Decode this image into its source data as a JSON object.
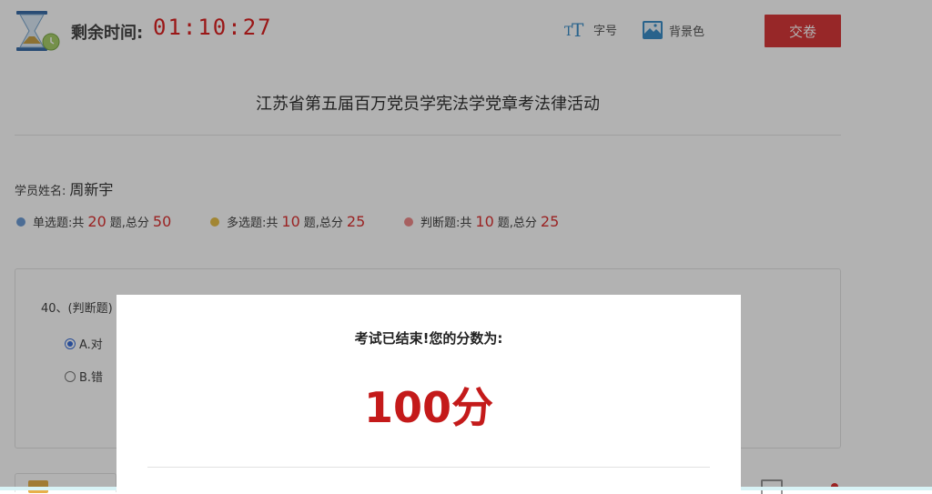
{
  "header": {
    "timer_label": "剩余时间:",
    "timer_value": "01:10:27",
    "font_size_label": "字号",
    "background_color_label": "背景色",
    "submit_label": "交卷"
  },
  "exam": {
    "title": "江苏省第五届百万党员学宪法学党章考法律活动"
  },
  "student": {
    "label": "学员姓名:",
    "name": "周新宇"
  },
  "stats": [
    {
      "type": "单选题",
      "count": "20",
      "score": "50",
      "color": "#6e9dd6"
    },
    {
      "type": "多选题",
      "count": "10",
      "score": "25",
      "color": "#e8c04a"
    },
    {
      "type": "判断题",
      "count": "10",
      "score": "25",
      "color": "#f08a8a"
    }
  ],
  "stat_words": {
    "total_prefix": ":共",
    "question_unit": "题,总分"
  },
  "question": {
    "heading": "40、(判断题)",
    "options": [
      {
        "label": "A.对",
        "selected": true
      },
      {
        "label": "B.错",
        "selected": false
      }
    ]
  },
  "modal": {
    "message": "考试已结束!您的分数为:",
    "score": "100分"
  },
  "colors": {
    "accent_red": "#d9383a",
    "score_red": "#c41a1a"
  }
}
